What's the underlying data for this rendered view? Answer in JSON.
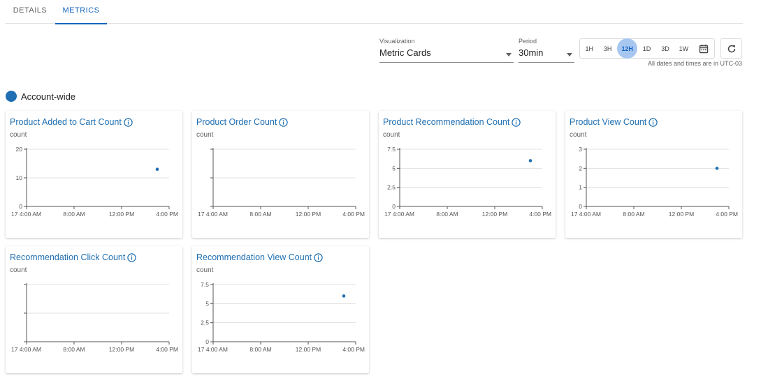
{
  "tabs": [
    {
      "label": "DETAILS"
    },
    {
      "label": "METRICS",
      "active": true
    }
  ],
  "controls": {
    "visualization": {
      "label": "Visualization",
      "value": "Metric Cards"
    },
    "period": {
      "label": "Period",
      "value": "30min"
    },
    "ranges": [
      "1H",
      "3H",
      "12H",
      "1D",
      "3D",
      "1W"
    ],
    "active_range": "12H",
    "calendar_icon": "calendar-icon",
    "refresh_icon": "refresh-icon",
    "timezone_note": "All dates and times are in UTC-03"
  },
  "group": {
    "label": "Account-wide",
    "color": "#1f6fb2"
  },
  "chart_data": [
    {
      "type": "scatter",
      "title": "Product Added to Cart Count",
      "ylabel": "count",
      "yticks": [
        "0",
        "10",
        "20"
      ],
      "ylim": [
        0,
        20
      ],
      "xticks": [
        "17 4:00 AM",
        "8:00 AM",
        "12:00 PM",
        "4:00 PM"
      ],
      "points": [
        {
          "x": "3:00 PM",
          "y": 13
        }
      ],
      "grid": true
    },
    {
      "type": "scatter",
      "title": "Product Order Count",
      "ylabel": "count",
      "yticks": [
        "",
        "",
        ""
      ],
      "ylim": [
        0,
        2
      ],
      "xticks": [
        "17 4:00 AM",
        "8:00 AM",
        "12:00 PM",
        "4:00 PM"
      ],
      "points": [],
      "grid": true
    },
    {
      "type": "scatter",
      "title": "Product Recommendation Count",
      "ylabel": "count",
      "yticks": [
        "0",
        "2.5",
        "5",
        "7.5"
      ],
      "ylim": [
        0,
        7.5
      ],
      "xticks": [
        "17 4:00 AM",
        "8:00 AM",
        "12:00 PM",
        "4:00 PM"
      ],
      "points": [
        {
          "x": "3:00 PM",
          "y": 6
        }
      ],
      "grid": true
    },
    {
      "type": "scatter",
      "title": "Product View Count",
      "ylabel": "count",
      "yticks": [
        "0",
        "1",
        "2",
        "3"
      ],
      "ylim": [
        0,
        3
      ],
      "xticks": [
        "17 4:00 AM",
        "8:00 AM",
        "12:00 PM",
        "4:00 PM"
      ],
      "points": [
        {
          "x": "3:00 PM",
          "y": 2
        }
      ],
      "grid": true
    },
    {
      "type": "scatter",
      "title": "Recommendation Click Count",
      "ylabel": "count",
      "yticks": [
        "",
        "",
        ""
      ],
      "ylim": [
        0,
        2
      ],
      "xticks": [
        "17 4:00 AM",
        "8:00 AM",
        "12:00 PM",
        "4:00 PM"
      ],
      "points": [],
      "grid": true
    },
    {
      "type": "scatter",
      "title": "Recommendation View Count",
      "ylabel": "count",
      "yticks": [
        "0",
        "2.5",
        "5",
        "7.5"
      ],
      "ylim": [
        0,
        7.5
      ],
      "xticks": [
        "17 4:00 AM",
        "8:00 AM",
        "12:00 PM",
        "4:00 PM"
      ],
      "points": [
        {
          "x": "3:00 PM",
          "y": 6
        }
      ],
      "grid": true
    }
  ],
  "colors": {
    "accent": "#1565c0",
    "point": "#1f6fb2",
    "grid": "#e0e0e0"
  }
}
